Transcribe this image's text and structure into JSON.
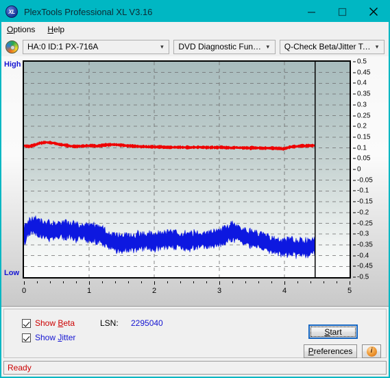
{
  "window": {
    "title": "PlexTools Professional XL V3.16",
    "icon": "xl-logo-icon",
    "minimize": "minimize-icon",
    "maximize": "maximize-icon",
    "close": "close-icon"
  },
  "menu": {
    "items": [
      {
        "label": "Options",
        "mnemonic": "O"
      },
      {
        "label": "Help",
        "mnemonic": "H"
      }
    ]
  },
  "toolbar": {
    "drive_icon": "disc-icon",
    "drive": {
      "value": "HA:0 ID:1  PX-716A"
    },
    "function": {
      "value": "DVD Diagnostic Functions"
    },
    "test": {
      "value": "Q-Check Beta/Jitter Test"
    },
    "arrow": "⌄"
  },
  "chart_data": {
    "type": "line",
    "title": "",
    "xlabel": "",
    "ylabel": "",
    "xlim": [
      0,
      5
    ],
    "ylim": [
      -0.5,
      0.5
    ],
    "xticks": [
      0,
      1,
      2,
      3,
      4,
      5
    ],
    "xtick_labels": [
      "0",
      "1",
      "2",
      "3",
      "4",
      "5"
    ],
    "yticks": [
      0.5,
      0.45,
      0.4,
      0.35,
      0.3,
      0.25,
      0.2,
      0.15,
      0.1,
      0.05,
      0,
      -0.05,
      -0.1,
      -0.15,
      -0.2,
      -0.25,
      -0.3,
      -0.35,
      -0.4,
      -0.45,
      -0.5
    ],
    "ytick_labels": [
      "0.5",
      "0.45",
      "0.4",
      "0.35",
      "0.3",
      "0.25",
      "0.2",
      "0.15",
      "0.1",
      "0.05",
      "0",
      "-0.05",
      "-0.1",
      "-0.15",
      "-0.2",
      "-0.25",
      "-0.3",
      "-0.35",
      "-0.4",
      "-0.45",
      "-0.5"
    ],
    "axis_top_label": "High",
    "axis_bottom_label": "Low",
    "grid": true,
    "grid_style": "dashed",
    "data_end_x": 4.47,
    "legend": [
      "Beta",
      "Jitter"
    ],
    "series": [
      {
        "name": "Beta",
        "color": "#ee0000",
        "x": [
          0.0,
          0.08,
          0.16,
          0.24,
          0.32,
          0.4,
          0.48,
          0.56,
          0.64,
          0.72,
          0.8,
          0.88,
          0.96,
          1.04,
          1.12,
          1.2,
          1.28,
          1.36,
          1.44,
          1.52,
          1.6,
          1.68,
          1.76,
          1.84,
          1.92,
          2.0,
          2.08,
          2.16,
          2.24,
          2.32,
          2.4,
          2.48,
          2.56,
          2.64,
          2.72,
          2.8,
          2.88,
          2.96,
          3.04,
          3.12,
          3.2,
          3.28,
          3.36,
          3.44,
          3.52,
          3.6,
          3.68,
          3.76,
          3.84,
          3.92,
          4.0,
          4.08,
          4.16,
          4.24,
          4.32,
          4.4,
          4.47
        ],
        "values": [
          0.11,
          0.106,
          0.113,
          0.122,
          0.126,
          0.125,
          0.12,
          0.115,
          0.112,
          0.109,
          0.107,
          0.108,
          0.11,
          0.11,
          0.109,
          0.111,
          0.113,
          0.115,
          0.114,
          0.112,
          0.11,
          0.108,
          0.107,
          0.106,
          0.105,
          0.105,
          0.104,
          0.104,
          0.103,
          0.103,
          0.103,
          0.102,
          0.102,
          0.103,
          0.103,
          0.102,
          0.102,
          0.102,
          0.102,
          0.101,
          0.101,
          0.101,
          0.1,
          0.1,
          0.1,
          0.099,
          0.099,
          0.099,
          0.098,
          0.098,
          0.096,
          0.104,
          0.107,
          0.108,
          0.11,
          0.111,
          0.112
        ],
        "band": 0.006
      },
      {
        "name": "Jitter",
        "color": "#0d18e0",
        "x": [
          0.0,
          0.08,
          0.16,
          0.24,
          0.32,
          0.4,
          0.48,
          0.56,
          0.64,
          0.72,
          0.8,
          0.88,
          0.96,
          1.04,
          1.12,
          1.2,
          1.28,
          1.36,
          1.44,
          1.52,
          1.6,
          1.68,
          1.76,
          1.84,
          1.92,
          2.0,
          2.08,
          2.16,
          2.24,
          2.32,
          2.4,
          2.48,
          2.56,
          2.64,
          2.72,
          2.8,
          2.88,
          2.96,
          3.04,
          3.12,
          3.2,
          3.28,
          3.36,
          3.44,
          3.52,
          3.6,
          3.68,
          3.76,
          3.84,
          3.92,
          4.0,
          4.08,
          4.16,
          4.24,
          4.32,
          4.4,
          4.47
        ],
        "values": [
          -0.3,
          -0.268,
          -0.262,
          -0.272,
          -0.28,
          -0.283,
          -0.281,
          -0.278,
          -0.28,
          -0.284,
          -0.287,
          -0.289,
          -0.292,
          -0.295,
          -0.298,
          -0.303,
          -0.33,
          -0.337,
          -0.34,
          -0.341,
          -0.34,
          -0.338,
          -0.334,
          -0.333,
          -0.334,
          -0.336,
          -0.33,
          -0.325,
          -0.324,
          -0.327,
          -0.331,
          -0.334,
          -0.333,
          -0.33,
          -0.327,
          -0.325,
          -0.322,
          -0.318,
          -0.312,
          -0.3,
          -0.288,
          -0.297,
          -0.312,
          -0.318,
          -0.322,
          -0.328,
          -0.34,
          -0.346,
          -0.352,
          -0.355,
          -0.357,
          -0.36,
          -0.362,
          -0.364,
          -0.366,
          -0.362,
          -0.352
        ],
        "band": 0.034
      }
    ]
  },
  "controls": {
    "show_beta": {
      "label": "Show Beta",
      "mnemonic": "B",
      "checked": true,
      "color": "#cc0000"
    },
    "show_jitter": {
      "label": "Show Jitter",
      "mnemonic": "J",
      "checked": true,
      "color": "#1414d2"
    },
    "lsn_label": "LSN:",
    "lsn_value": "2295040",
    "start_button": {
      "label": "Start",
      "mnemonic": "S"
    },
    "preferences_button": {
      "label": "Preferences",
      "mnemonic": "P"
    },
    "info_button": {
      "icon": "info-icon",
      "glyph": "i"
    }
  },
  "statusbar": {
    "text": "Ready"
  }
}
